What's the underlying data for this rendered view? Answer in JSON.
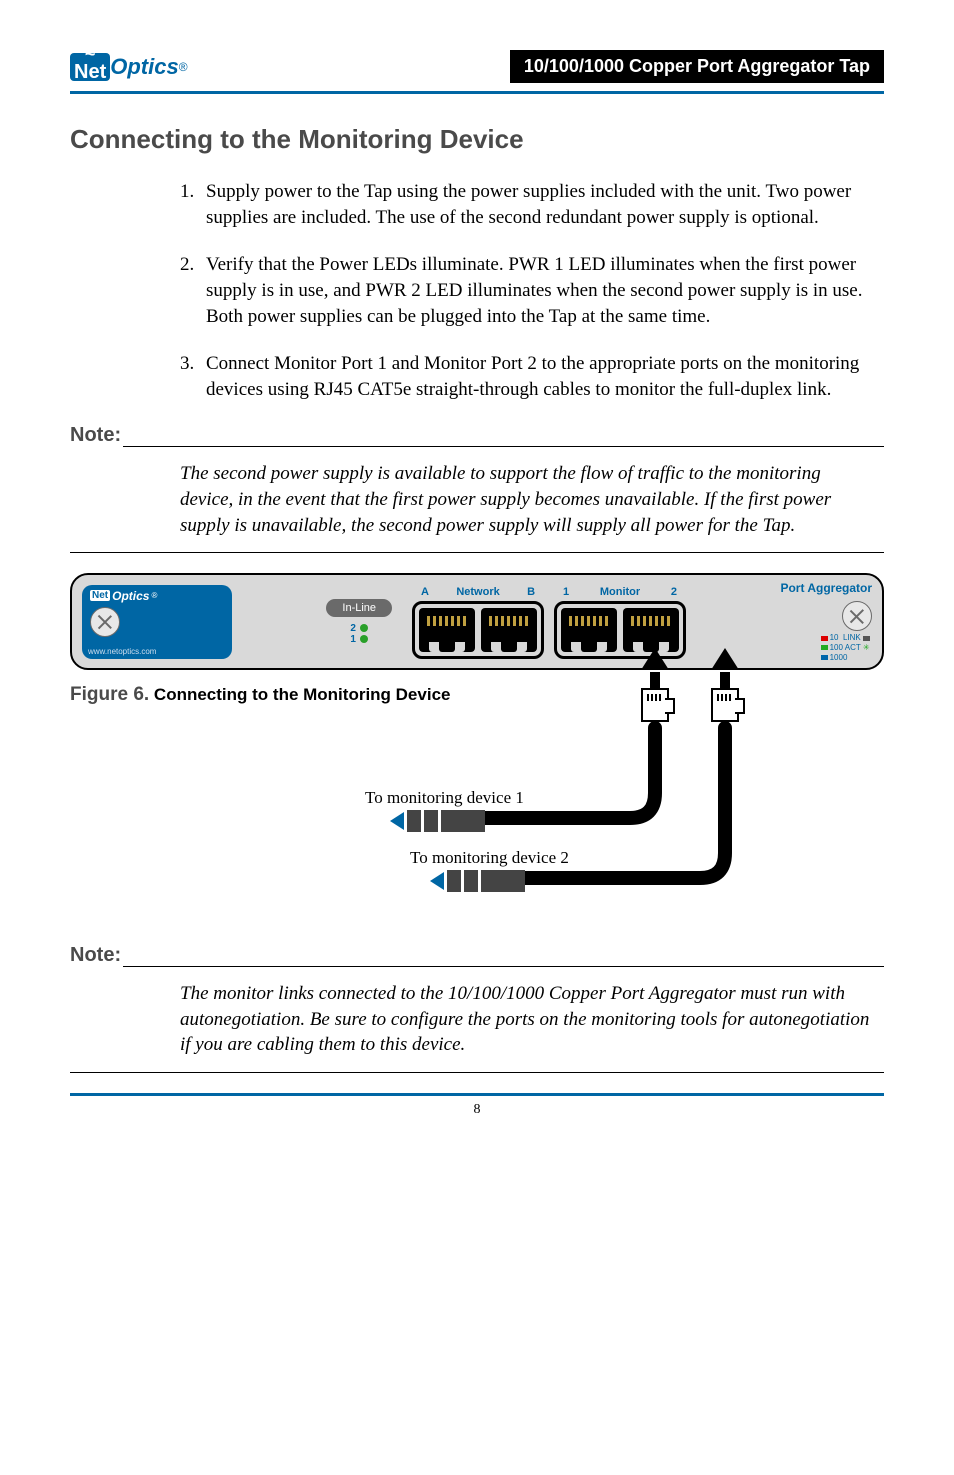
{
  "header": {
    "logo_net": "Net",
    "logo_optics": "Optics",
    "logo_reg": "®",
    "title_bar": "10/100/1000 Copper Port Aggregator Tap"
  },
  "section_heading": "Connecting to the Monitoring Device",
  "steps": {
    "s1_num": "1.",
    "s1": "Supply power to the Tap using the power supplies included with the unit. Two power supplies are included. The use of the second redundant power supply is optional.",
    "s2_num": "2.",
    "s2": "Verify that the Power LEDs illuminate. PWR 1 LED illuminates when the first power supply is in use, and PWR 2 LED illuminates when the second power supply is in use. Both power supplies can be plugged into the Tap at the same time.",
    "s3_num": "3.",
    "s3": "Connect Monitor Port 1 and Monitor Port 2 to the appropriate ports on the monitoring devices using RJ45 CAT5e straight-through cables to monitor the full-duplex link."
  },
  "note_label": "Note:",
  "note1": "The second power supply is available to support the flow of traffic to the monitoring device, in the event that the first power supply becomes unavailable. If the first power supply is unavailable, the second power supply will supply all power for the Tap.",
  "device": {
    "brand_net": "Net",
    "brand_optics": "Optics",
    "brand_reg": "®",
    "url": "www.netoptics.com",
    "inline": "In-Line",
    "p2": "2",
    "p1": "1",
    "network_A": "A",
    "network_label": "Network",
    "network_B": "B",
    "monitor_1": "1",
    "monitor_label": "Monitor",
    "monitor_2": "2",
    "right_label": "Port Aggregator",
    "link": "LINK",
    "act": "ACT",
    "s10": "10",
    "s100": "100",
    "s1000": "1000"
  },
  "figure": {
    "num": "Figure 6.",
    "caption": "Connecting to the Monitoring Device"
  },
  "cables": {
    "c1": "To monitoring device 1",
    "c2": "To monitoring device 2"
  },
  "note2": "The monitor links connected to the 10/100/1000 Copper Port Aggregator must run with autonegotiation. Be sure to configure the ports on the monitoring tools for autonegotiation if you are cabling them to this device.",
  "page_number": "8"
}
